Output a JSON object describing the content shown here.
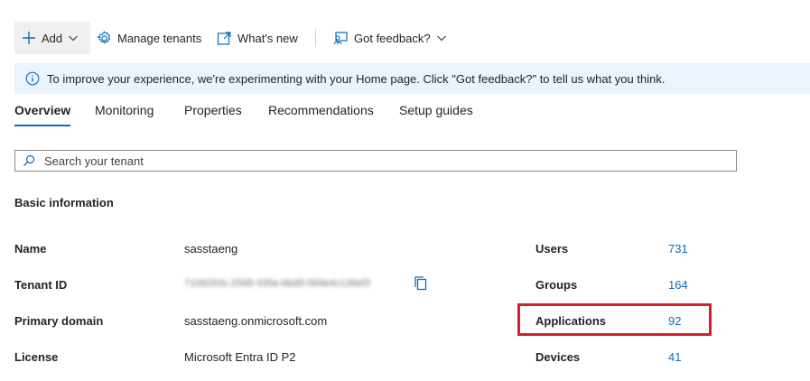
{
  "toolbar": {
    "add_label": "Add",
    "manage_tenants_label": "Manage tenants",
    "whats_new_label": "What's new",
    "feedback_label": "Got feedback?"
  },
  "banner": {
    "text": "To improve your experience, we're experimenting with your Home page. Click \"Got feedback?\" to tell us what you think."
  },
  "tabs": [
    {
      "label": "Overview",
      "active": true
    },
    {
      "label": "Monitoring"
    },
    {
      "label": "Properties"
    },
    {
      "label": "Recommendations"
    },
    {
      "label": "Setup guides"
    }
  ],
  "search": {
    "placeholder": "Search your tenant"
  },
  "basic_info": {
    "title": "Basic information",
    "rows": [
      {
        "label": "Name",
        "value": "sasstaeng"
      },
      {
        "label": "Tenant ID",
        "value": "7106293c-2568-435e-bbd9-569e4c136ef3"
      },
      {
        "label": "Primary domain",
        "value": "sasstaeng.onmicrosoft.com"
      },
      {
        "label": "License",
        "value": "Microsoft Entra ID P2"
      }
    ],
    "stats": [
      {
        "label": "Users",
        "value": "731"
      },
      {
        "label": "Groups",
        "value": "164"
      },
      {
        "label": "Applications",
        "value": "92"
      },
      {
        "label": "Devices",
        "value": "41"
      }
    ]
  },
  "colors": {
    "accent": "#0f6cbd",
    "highlight": "#d32029",
    "banner_bg": "#ebf3fc"
  }
}
